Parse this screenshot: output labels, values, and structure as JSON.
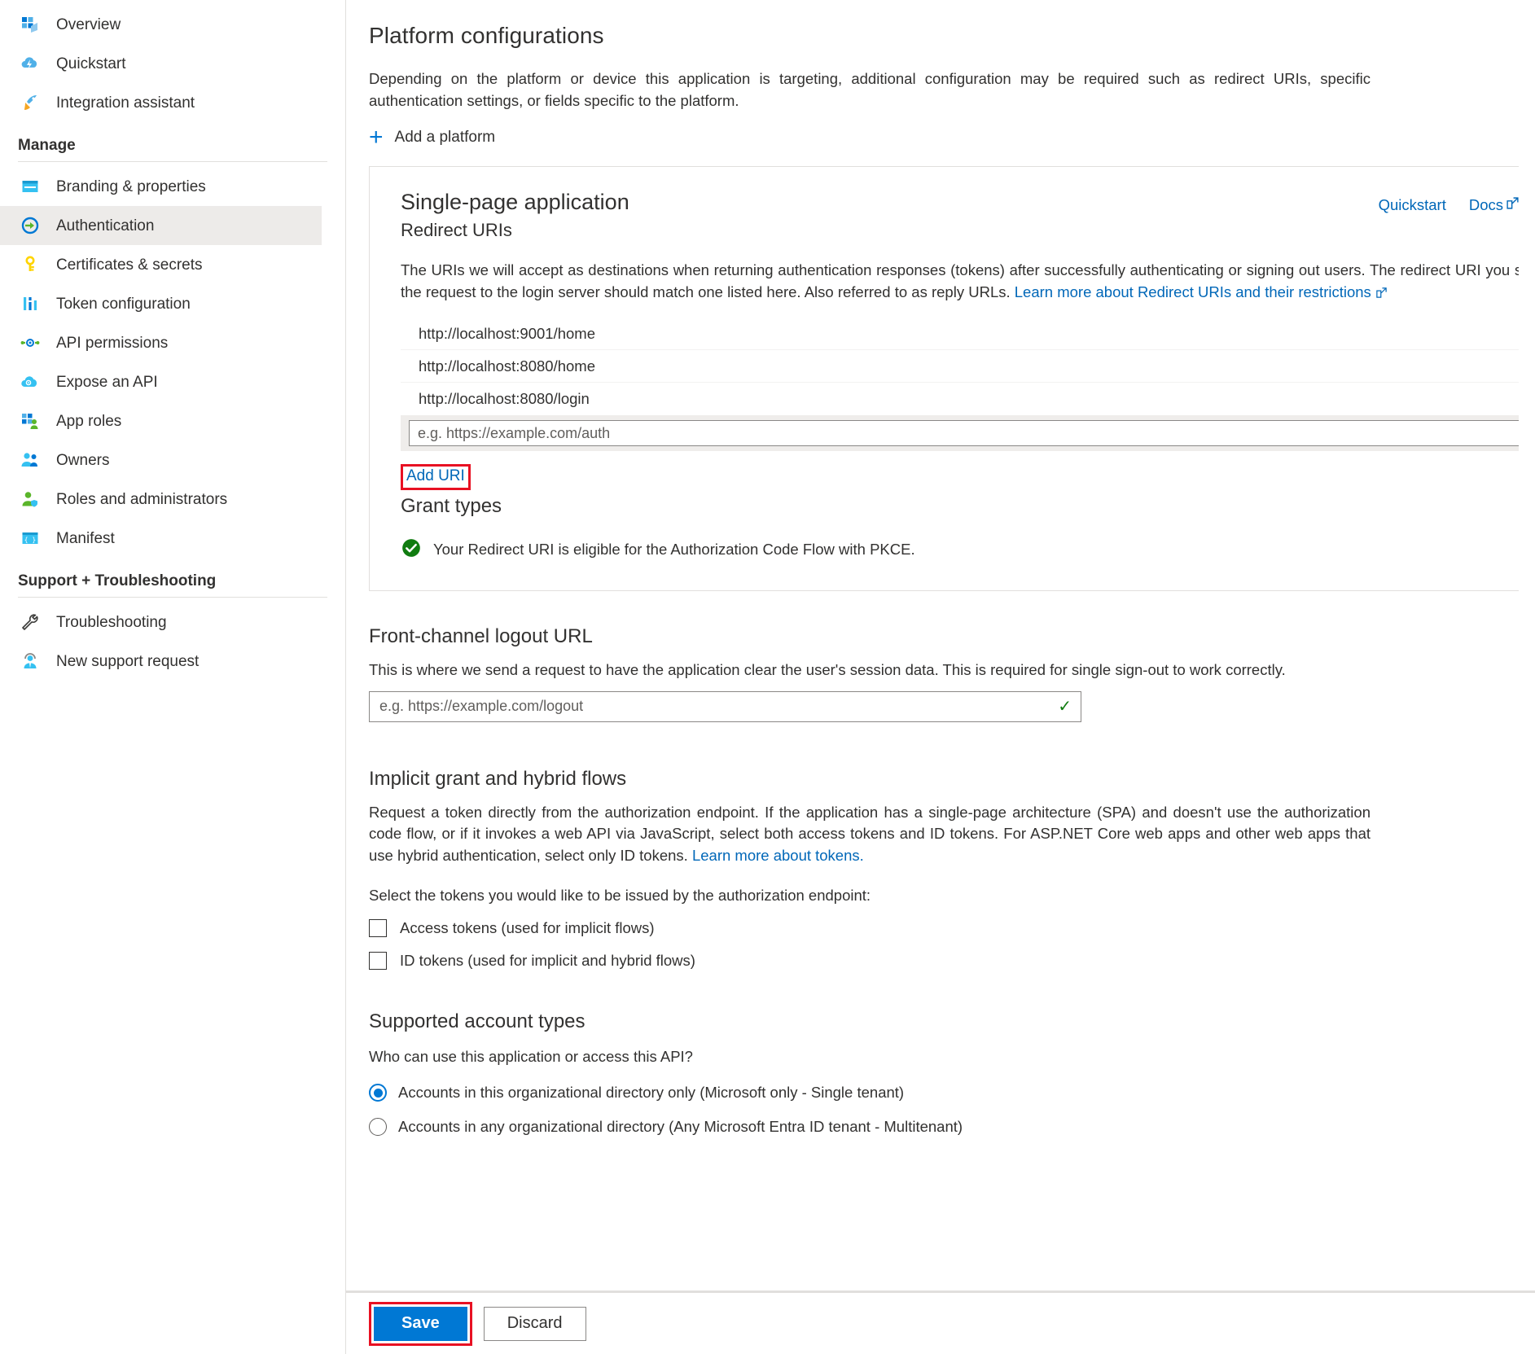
{
  "sidebar": {
    "top_items": [
      {
        "label": "Overview",
        "icon": "overview-grid-icon"
      },
      {
        "label": "Quickstart",
        "icon": "cloud-lightning-icon"
      },
      {
        "label": "Integration assistant",
        "icon": "rocket-icon"
      }
    ],
    "groups": [
      {
        "heading": "Manage",
        "items": [
          {
            "label": "Branding & properties",
            "icon": "browser-window-icon"
          },
          {
            "label": "Authentication",
            "icon": "arrow-circle-icon",
            "selected": true
          },
          {
            "label": "Certificates & secrets",
            "icon": "key-icon"
          },
          {
            "label": "Token configuration",
            "icon": "bars-icon"
          },
          {
            "label": "API permissions",
            "icon": "api-node-icon"
          },
          {
            "label": "Expose an API",
            "icon": "cloud-gear-icon"
          },
          {
            "label": "App roles",
            "icon": "grid-person-icon"
          },
          {
            "label": "Owners",
            "icon": "people-icon"
          },
          {
            "label": "Roles and administrators",
            "icon": "person-shield-icon"
          },
          {
            "label": "Manifest",
            "icon": "code-braces-icon"
          }
        ]
      },
      {
        "heading": "Support + Troubleshooting",
        "items": [
          {
            "label": "Troubleshooting",
            "icon": "wrench-icon"
          },
          {
            "label": "New support request",
            "icon": "support-person-icon"
          }
        ]
      }
    ]
  },
  "main": {
    "platform_configurations": {
      "title": "Platform configurations",
      "description": "Depending on the platform or device this application is targeting, additional configuration may be required such as redirect URIs, specific authentication settings, or fields specific to the platform.",
      "add_platform_label": "Add a platform"
    },
    "platform_card": {
      "title": "Single-page application",
      "subtitle": "Redirect URIs",
      "quickstart_label": "Quickstart",
      "docs_label": "Docs",
      "description_part1": "The URIs we will accept as destinations when returning authentication responses (tokens) after successfully authenticating or signing out users. The redirect URI you send in the request to the login server should match one listed here. Also referred to as reply URLs. ",
      "description_link": "Learn more about Redirect URIs and their restrictions",
      "redirect_uris": [
        "http://localhost:9001/home",
        "http://localhost:8080/home",
        "http://localhost:8080/login"
      ],
      "new_uri_placeholder": "e.g. https://example.com/auth",
      "new_uri_value": "",
      "add_uri_label": "Add URI",
      "grant_types_title": "Grant types",
      "grant_types_message": "Your Redirect URI is eligible for the Authorization Code Flow with PKCE."
    },
    "front_channel_logout": {
      "title": "Front-channel logout URL",
      "description": "This is where we send a request to have the application clear the user's session data. This is required for single sign-out to work correctly.",
      "placeholder": "e.g. https://example.com/logout",
      "value": ""
    },
    "implicit_grant": {
      "title": "Implicit grant and hybrid flows",
      "description_part1": "Request a token directly from the authorization endpoint. If the application has a single-page architecture (SPA) and doesn't use the authorization code flow, or if it invokes a web API via JavaScript, select both access tokens and ID tokens. For ASP.NET Core web apps and other web apps that use hybrid authentication, select only ID tokens. ",
      "description_link": "Learn more about tokens.",
      "select_label": "Select the tokens you would like to be issued by the authorization endpoint:",
      "checkboxes": [
        {
          "label": "Access tokens (used for implicit flows)",
          "checked": false
        },
        {
          "label": "ID tokens (used for implicit and hybrid flows)",
          "checked": false
        }
      ]
    },
    "supported_account_types": {
      "title": "Supported account types",
      "question": "Who can use this application or access this API?",
      "options": [
        {
          "label": "Accounts in this organizational directory only (Microsoft only - Single tenant)",
          "selected": true
        },
        {
          "label": "Accounts in any organizational directory (Any Microsoft Entra ID tenant - Multitenant)",
          "selected": false
        }
      ]
    }
  },
  "footer": {
    "save_label": "Save",
    "discard_label": "Discard"
  },
  "colors": {
    "accent": "#0078d4",
    "link": "#0067b8",
    "highlight_red": "#e81123",
    "success_green": "#107c10"
  }
}
